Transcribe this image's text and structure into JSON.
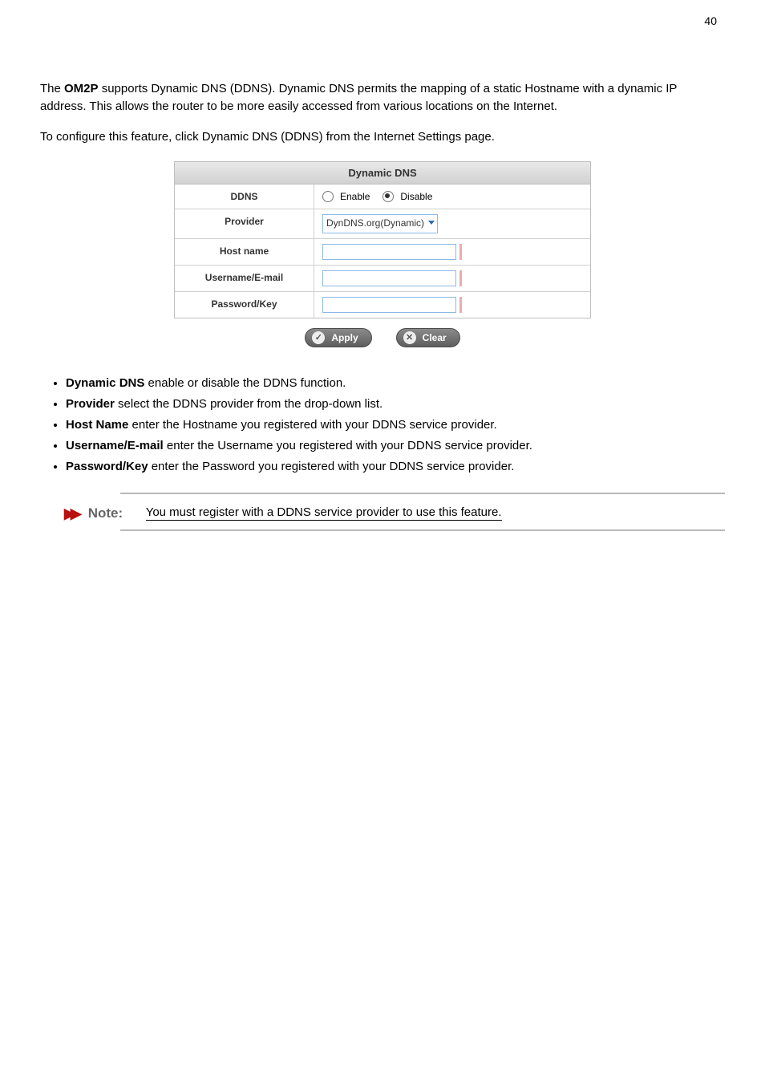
{
  "page_number": "40",
  "intro_prefix": "The ",
  "intro_brand": "OM2P",
  "intro_suffix": " supports Dynamic DNS (DDNS). Dynamic DNS permits the mapping of a static Hostname with a dynamic IP address. This allows the router to be more easily accessed from various locations on the Internet.",
  "subintro": "To configure this feature, click Dynamic DNS (DDNS) from the Internet Settings page.",
  "panel": {
    "header": "Dynamic DNS",
    "rows": {
      "ddns_label": "DDNS",
      "enable": "Enable",
      "disable": "Disable",
      "provider_label": "Provider",
      "provider_value": "DynDNS.org(Dynamic)",
      "hostname_label": "Host name",
      "username_label": "Username/E-mail",
      "password_label": "Password/Key"
    },
    "apply": "Apply",
    "clear": "Clear"
  },
  "defs": [
    {
      "term": "Dynamic DNS",
      "desc": " enable or disable the DDNS function."
    },
    {
      "term": "Provider",
      "desc": " select the DDNS provider from the drop-down list."
    },
    {
      "term": "Host Name",
      "desc": " enter the Hostname you registered with your DDNS service provider."
    },
    {
      "term": "Username/E-mail",
      "desc": " enter the Username you registered with your DDNS service provider."
    },
    {
      "term": "Password/Key",
      "desc": " enter the Password you registered with your DDNS service provider."
    }
  ],
  "note_label": "Note:",
  "note_text": "You must register with a DDNS service provider to use this feature."
}
